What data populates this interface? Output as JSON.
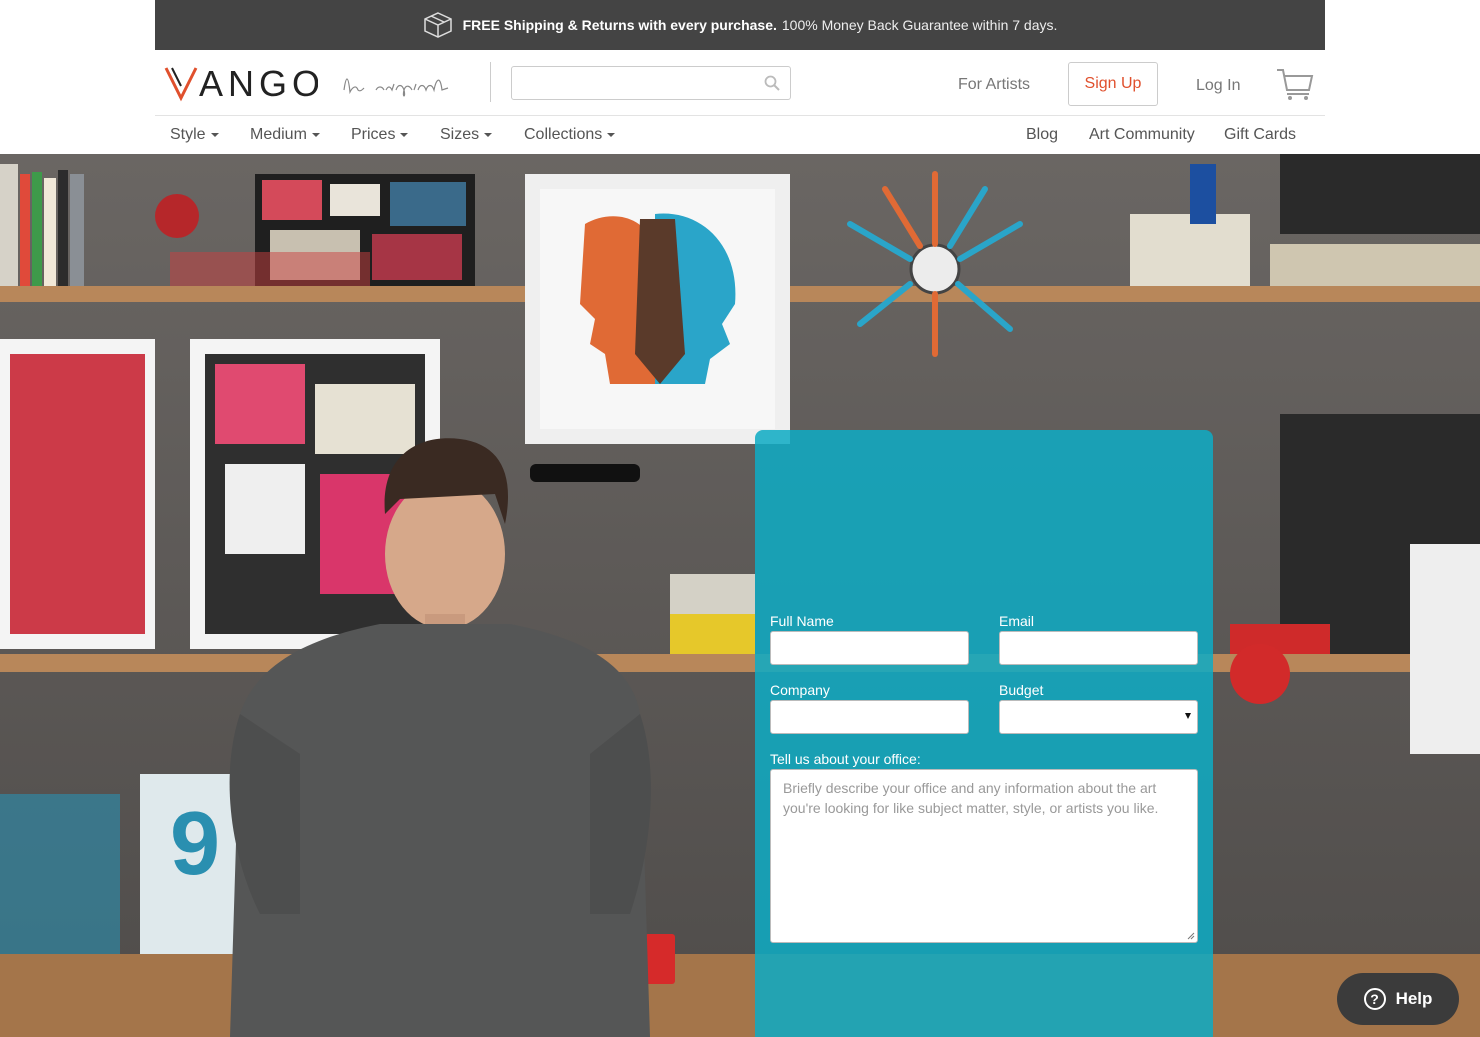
{
  "promo": {
    "bold": "FREE Shipping & Returns with every purchase.",
    "rest": "100% Money Back Guarantee within 7 days."
  },
  "header": {
    "logo_text": "VANGO",
    "tagline": "be original",
    "search_placeholder": "",
    "for_artists": "For Artists",
    "sign_up": "Sign Up",
    "log_in": "Log In"
  },
  "catnav": {
    "left": [
      "Style",
      "Medium",
      "Prices",
      "Sizes",
      "Collections"
    ],
    "right": [
      "Blog",
      "Art Community",
      "Gift Cards"
    ]
  },
  "form": {
    "full_name_label": "Full Name",
    "email_label": "Email",
    "company_label": "Company",
    "budget_label": "Budget",
    "budget_value": "",
    "office_label": "Tell us about your office:",
    "office_placeholder": "Briefly describe your office and any information about the art you're looking for like subject matter, style, or artists you like."
  },
  "help": {
    "label": "Help"
  },
  "colors": {
    "accent": "#e0502d",
    "panel": "#0eabc4",
    "banner": "#444444"
  }
}
